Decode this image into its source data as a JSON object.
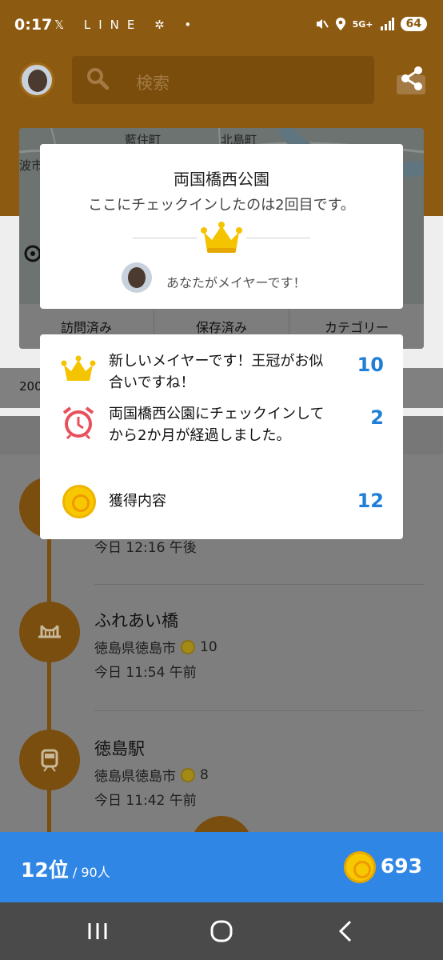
{
  "status_bar": {
    "time": "0:17",
    "left_icons": "𝕏 LINE ✲ •",
    "network": "5G+",
    "battery": "64"
  },
  "header": {
    "search_placeholder": "検索"
  },
  "map": {
    "labels": [
      "藍住町",
      "北島町",
      "波市"
    ],
    "tabs": [
      "訪問済み",
      "保存済み",
      "カテゴリー"
    ]
  },
  "year_row": "200",
  "timeline": [
    {
      "title": "",
      "place": "",
      "points": "",
      "time": "今日 12:16 午後",
      "icon": "park-icon"
    },
    {
      "title": "ふれあい橋",
      "place": "徳島県徳島市",
      "points": "10",
      "time": "今日 11:54 午前",
      "icon": "bridge-icon"
    },
    {
      "title": "徳島駅",
      "place": "徳島県徳島市",
      "points": "8",
      "time": "今日 11:42 午前",
      "icon": "train-icon"
    }
  ],
  "rank_bar": {
    "rank": "12位",
    "total": " / 90人",
    "coins": "693"
  },
  "checkin_dialog": {
    "venue": "両国橋西公園",
    "message": "ここにチェックインしたのは2回目です。",
    "mayor_text": "あなたがメイヤーです！"
  },
  "rewards_dialog": {
    "rows": [
      {
        "text": "新しいメイヤーです！王冠がお似合いですね！",
        "value": "10",
        "icon": "crown-icon"
      },
      {
        "text": "両国橋西公園にチェックインしてから2か月が経過しました。",
        "value": "2",
        "icon": "alarm-clock-icon"
      },
      {
        "text": "獲得内容",
        "value": "12",
        "icon": "coin-icon"
      }
    ]
  },
  "colors": {
    "orange_dim": "#8c5a10",
    "blue": "#2f86e4",
    "reward_value": "#1f7fd8",
    "crown_yellow": "#f5c400",
    "alarm_red": "#e8505b"
  }
}
